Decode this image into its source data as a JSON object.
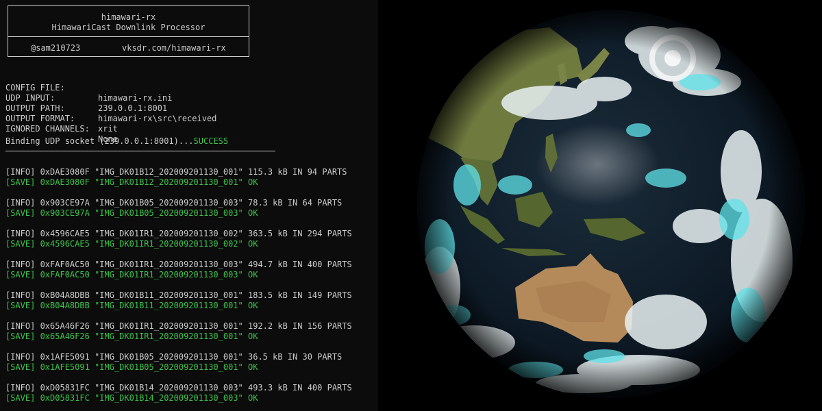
{
  "banner": {
    "title": "himawari-rx",
    "subtitle": "HimawariCast Downlink Processor",
    "handle": "@sam210723",
    "url": "vksdr.com/himawari-rx"
  },
  "config": [
    {
      "key": "CONFIG FILE:",
      "value": "himawari-rx.ini"
    },
    {
      "key": "UDP INPUT:",
      "value": "239.0.0.1:8001"
    },
    {
      "key": "OUTPUT PATH:",
      "value": "himawari-rx\\src\\received"
    },
    {
      "key": "OUTPUT FORMAT:",
      "value": "xrit"
    },
    {
      "key": "IGNORED CHANNELS:",
      "value": "None"
    }
  ],
  "binding": {
    "text": "Binding UDP socket (239.0.0.1:8001)...",
    "status": "SUCCESS"
  },
  "log": [
    {
      "info": "[INFO] 0xDAE3080F \"IMG_DK01B12_202009201130_001\" 115.3 kB IN 94 PARTS",
      "save": "[SAVE] 0xDAE3080F \"IMG_DK01B12_202009201130_001\" OK"
    },
    {
      "info": "[INFO] 0x903CE97A \"IMG_DK01B05_202009201130_003\" 78.3 kB IN 64 PARTS",
      "save": "[SAVE] 0x903CE97A \"IMG_DK01B05_202009201130_003\" OK"
    },
    {
      "info": "[INFO] 0x4596CAE5 \"IMG_DK01IR1_202009201130_002\" 363.5 kB IN 294 PARTS",
      "save": "[SAVE] 0x4596CAE5 \"IMG_DK01IR1_202009201130_002\" OK"
    },
    {
      "info": "[INFO] 0xFAF0AC50 \"IMG_DK01IR1_202009201130_003\" 494.7 kB IN 400 PARTS",
      "save": "[SAVE] 0xFAF0AC50 \"IMG_DK01IR1_202009201130_003\" OK"
    },
    {
      "info": "[INFO] 0xB04A8DBB \"IMG_DK01B11_202009201130_001\" 183.5 kB IN 149 PARTS",
      "save": "[SAVE] 0xB04A8DBB \"IMG_DK01B11_202009201130_001\" OK"
    },
    {
      "info": "[INFO] 0x65A46F26 \"IMG_DK01IR1_202009201130_001\" 192.2 kB IN 156 PARTS",
      "save": "[SAVE] 0x65A46F26 \"IMG_DK01IR1_202009201130_001\" OK"
    },
    {
      "info": "[INFO] 0x1AFE5091 \"IMG_DK01B05_202009201130_001\" 36.5 kB IN 30 PARTS",
      "save": "[SAVE] 0x1AFE5091 \"IMG_DK01B05_202009201130_001\" OK"
    },
    {
      "info": "[INFO] 0xD05831FC \"IMG_DK01B14_202009201130_003\" 493.3 kB IN 400 PARTS",
      "save": "[SAVE] 0xD05831FC \"IMG_DK01B14_202009201130_003\" OK"
    }
  ],
  "colors": {
    "terminal_bg": "#0c0c0c",
    "terminal_text": "#cccccc",
    "success_green": "#3bc54a",
    "ocean": "#0a1622",
    "land": "#6f7a3f",
    "australia": "#b58a5a",
    "cloud": "#e9f1f2",
    "cloud_cyan": "#5fe3ea"
  },
  "earth": {
    "icon": "earth-globe-image"
  }
}
